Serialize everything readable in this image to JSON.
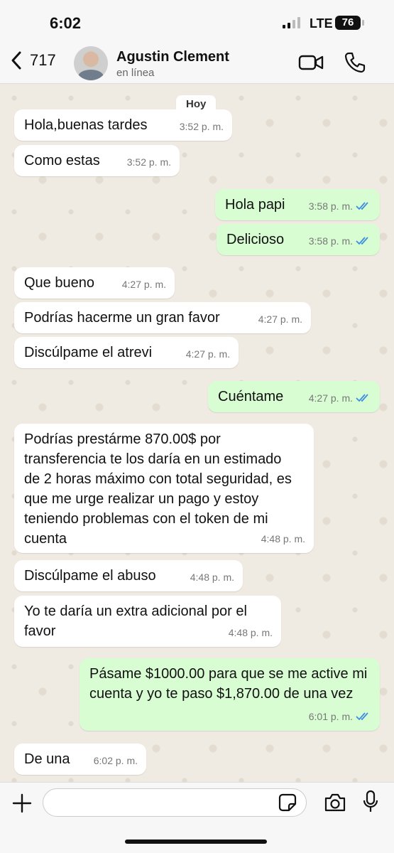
{
  "status_bar": {
    "time": "6:02",
    "network": "LTE",
    "battery": "76"
  },
  "header": {
    "back_count": "717",
    "contact_name": "Agustin Clement",
    "contact_status": "en línea"
  },
  "chat": {
    "day_label": "Hoy",
    "messages": [
      {
        "dir": "in",
        "text": "Hola,buenas tardes",
        "time": "3:52 p. m."
      },
      {
        "dir": "in",
        "text": "Como estas",
        "time": "3:52 p. m."
      },
      {
        "dir": "out",
        "text": "Hola papi",
        "time": "3:58 p. m."
      },
      {
        "dir": "out",
        "text": "Delicioso",
        "time": "3:58 p. m."
      },
      {
        "dir": "in",
        "text": "Que bueno",
        "time": "4:27 p. m."
      },
      {
        "dir": "in",
        "text": "Podrías hacerme un gran favor",
        "time": "4:27 p. m."
      },
      {
        "dir": "in",
        "text": "Discúlpame el atrevi",
        "time": "4:27 p. m."
      },
      {
        "dir": "out",
        "text": "Cuéntame",
        "time": "4:27 p. m."
      },
      {
        "dir": "in",
        "text": "Podrías prestárme 870.00$ por transferencia te los daría en un estimado de 2 horas máximo con total seguridad,  es que me urge realizar un pago y estoy teniendo problemas con el token de mi cuenta",
        "time": "4:48 p. m."
      },
      {
        "dir": "in",
        "text": "Discúlpame el abuso",
        "time": "4:48 p. m."
      },
      {
        "dir": "in",
        "text": "Yo te daría un extra adicional por el favor",
        "time": "4:48 p. m."
      },
      {
        "dir": "out",
        "text": "Pásame $1000.00 para que se me active mi cuenta y yo te paso $1,870.00 de una vez",
        "time": "6:01 p. m."
      },
      {
        "dir": "in",
        "text": "De una",
        "time": "6:02 p. m."
      }
    ]
  },
  "input": {
    "placeholder": ""
  },
  "colors": {
    "outgoing": "#d9fdd3",
    "incoming": "#ffffff",
    "read_ticks": "#3b8de0"
  }
}
